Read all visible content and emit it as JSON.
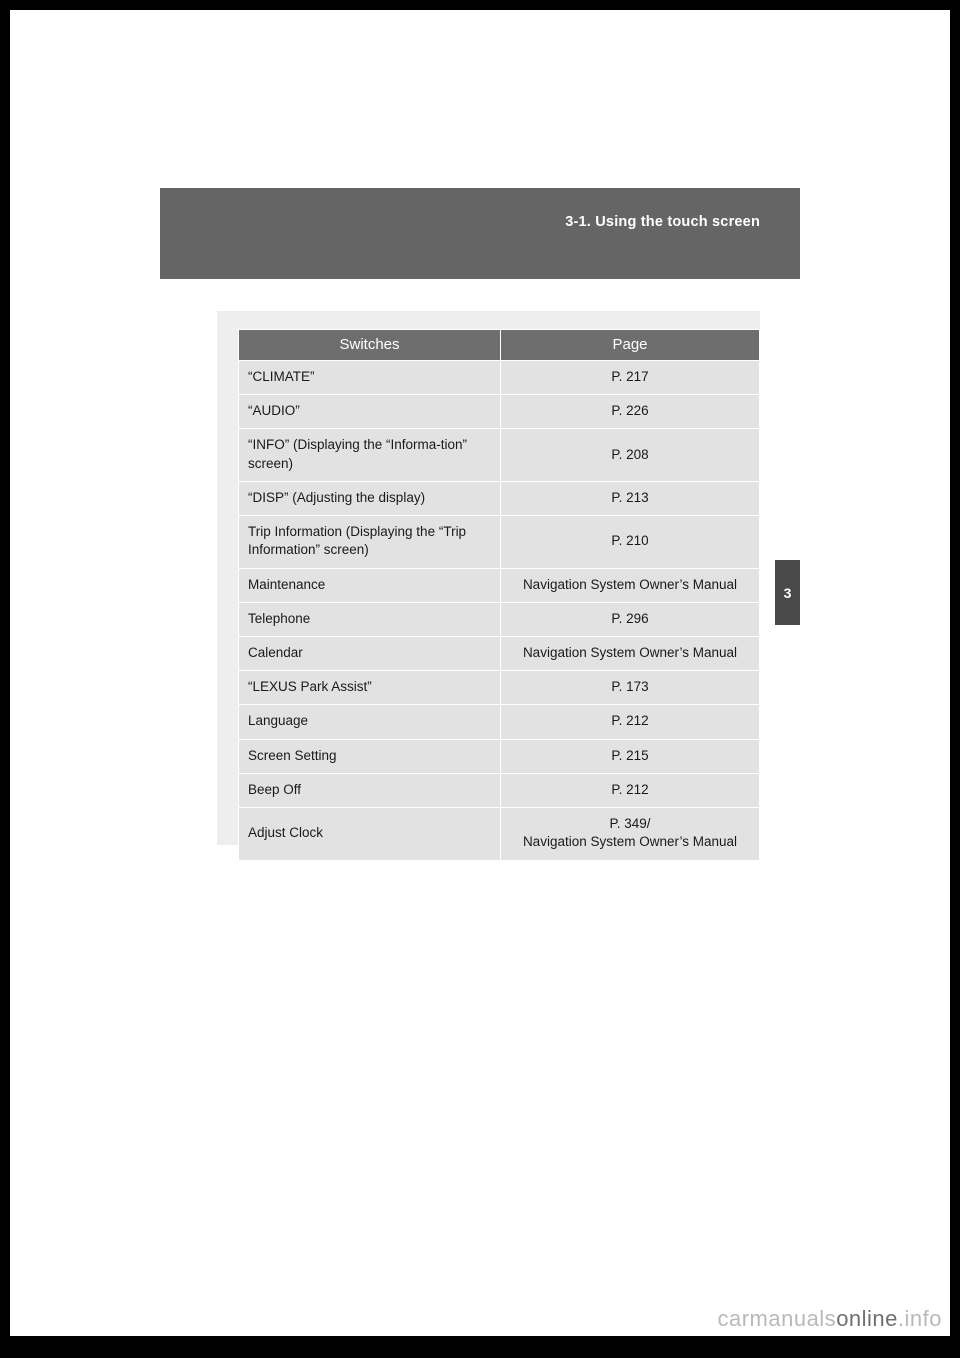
{
  "header": {
    "section_title": "3-1. Using the touch screen",
    "chapter_number": "3"
  },
  "table": {
    "columns": [
      "Switches",
      "Page"
    ],
    "rows": [
      {
        "switch": "“CLIMATE”",
        "page": "P. 217"
      },
      {
        "switch": "“AUDIO”",
        "page": "P. 226"
      },
      {
        "switch": "“INFO” (Displaying the “Informa-tion” screen)",
        "page": "P. 208"
      },
      {
        "switch": "“DISP” (Adjusting the display)",
        "page": "P. 213"
      },
      {
        "switch": "Trip Information (Displaying the “Trip Information” screen)",
        "page": "P. 210"
      },
      {
        "switch": "Maintenance",
        "page": "Navigation System Owner’s Manual"
      },
      {
        "switch": "Telephone",
        "page": "P. 296"
      },
      {
        "switch": "Calendar",
        "page": "Navigation System Owner’s Manual"
      },
      {
        "switch": "“LEXUS Park Assist”",
        "page": "P. 173"
      },
      {
        "switch": "Language",
        "page": "P. 212"
      },
      {
        "switch": "Screen Setting",
        "page": "P. 215"
      },
      {
        "switch": "Beep Off",
        "page": "P. 212"
      },
      {
        "switch": "Adjust Clock",
        "page": "P. 349/\nNavigation System Owner’s Manual"
      }
    ]
  },
  "watermark": {
    "part1": "carmanuals",
    "part2": "online",
    "part3": ".info"
  }
}
